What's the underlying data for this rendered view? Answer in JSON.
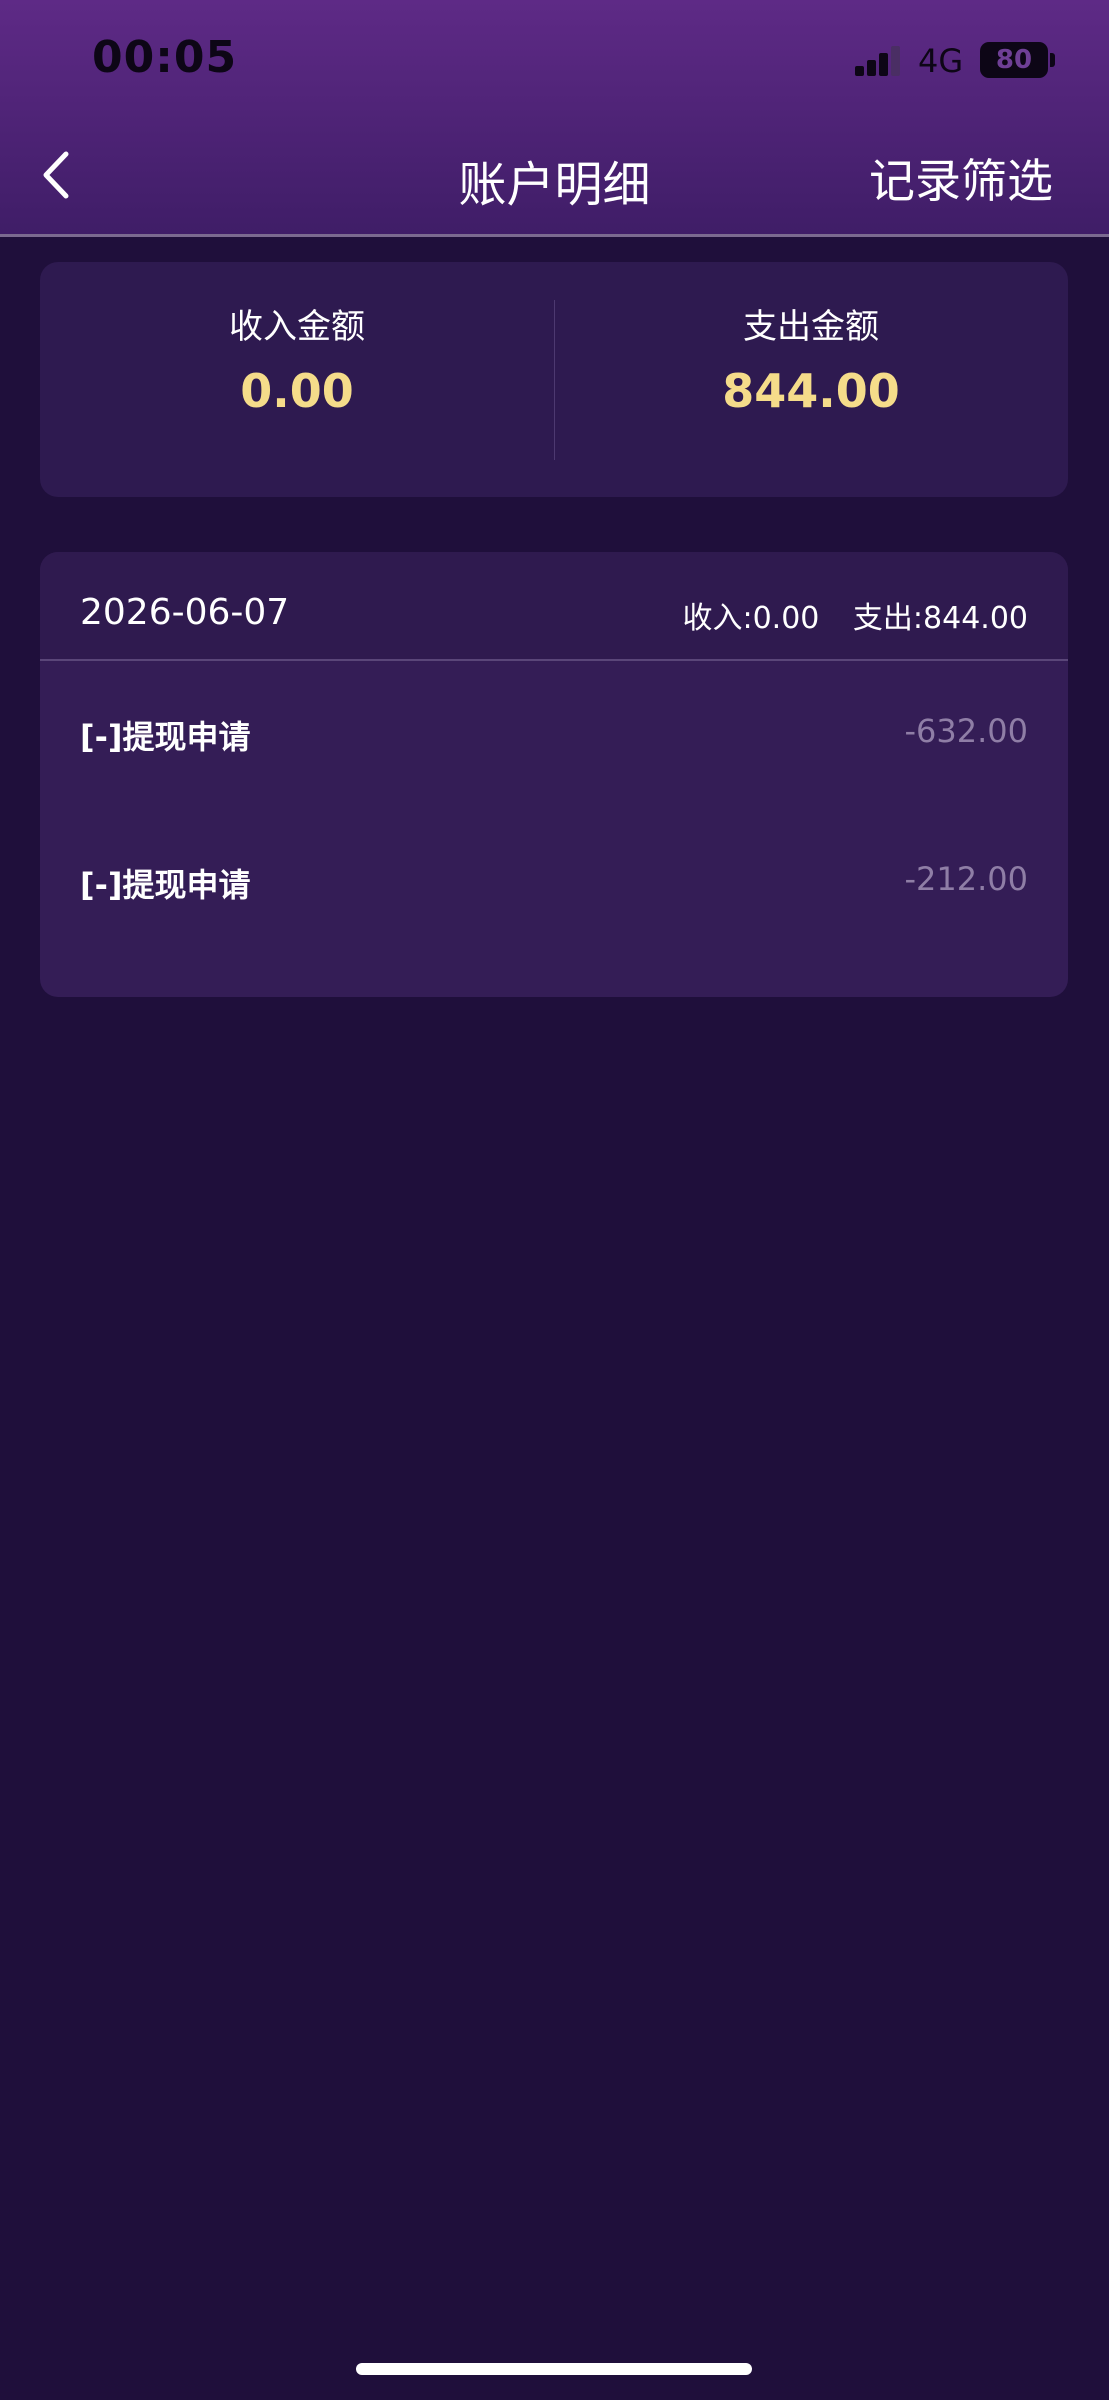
{
  "status_bar": {
    "time": "00:05",
    "network": "4G",
    "battery": "80"
  },
  "nav": {
    "back_icon": "chevron-left-icon",
    "title": "账户明细",
    "filter_label": "记录筛选"
  },
  "summary": {
    "income_label": "收入金额",
    "income_value": "0.00",
    "expense_label": "支出金额",
    "expense_value": "844.00"
  },
  "detail": {
    "date": "2026-06-07",
    "income_text": "收入:0.00",
    "expense_text": "支出:844.00",
    "records": [
      {
        "label": "[-]提现申请",
        "amount": "-632.00"
      },
      {
        "label": "[-]提现申请",
        "amount": "-212.00"
      }
    ]
  },
  "colors": {
    "accent_gold": "#f5dc8a",
    "background": "#1f0f3b",
    "card": "#341d56"
  }
}
